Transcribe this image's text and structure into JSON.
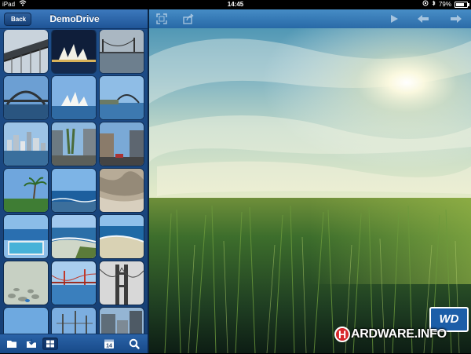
{
  "status_bar": {
    "carrier": "iPad",
    "time": "14:45",
    "battery_text": "79%",
    "battery_level": 0.79
  },
  "sidebar": {
    "back_label": "Back",
    "title": "DemoDrive",
    "thumbnails": [
      {
        "subject": "bridge-underside"
      },
      {
        "subject": "opera-house-night"
      },
      {
        "subject": "golden-gate-fog"
      },
      {
        "subject": "harbour-bridge"
      },
      {
        "subject": "opera-house-day"
      },
      {
        "subject": "bridge-harbour-view"
      },
      {
        "subject": "city-skyline-water"
      },
      {
        "subject": "city-street"
      },
      {
        "subject": "downtown-street"
      },
      {
        "subject": "park-palm-tree"
      },
      {
        "subject": "beach-sea"
      },
      {
        "subject": "rock-closeup"
      },
      {
        "subject": "ocean-pool"
      },
      {
        "subject": "coastline-waves"
      },
      {
        "subject": "beach-aerial"
      },
      {
        "subject": "pebbles"
      },
      {
        "subject": "golden-gate-water"
      },
      {
        "subject": "golden-gate-tower-bw"
      },
      {
        "subject": "blue-sky"
      },
      {
        "subject": "ship-masts"
      },
      {
        "subject": "buildings"
      }
    ],
    "toolbar": {
      "icons": [
        "folder-icon",
        "download-folder-icon",
        "grid-view-icon",
        "calendar-icon",
        "search-icon"
      ],
      "calendar_day": "14"
    }
  },
  "main": {
    "toolbar_icons": [
      "fullscreen-icon",
      "share-icon",
      "play-icon",
      "previous-icon",
      "next-icon"
    ],
    "photo_subject": "grass-field-sun-sky"
  },
  "watermark": {
    "wd_text": "WD",
    "site_initial": "H",
    "site_text": "ARDWARE.INFO"
  }
}
